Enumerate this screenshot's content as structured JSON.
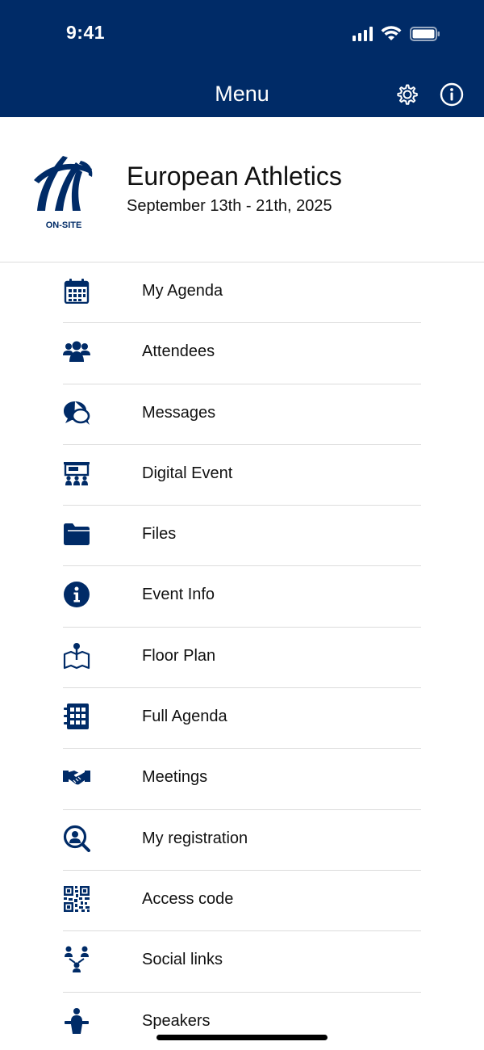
{
  "status_bar": {
    "time": "9:41"
  },
  "nav": {
    "title": "Menu",
    "settings_icon": "gear-icon",
    "info_icon": "info-circle-icon"
  },
  "event": {
    "name": "European Athletics",
    "dates": "September 13th - 21th, 2025",
    "logo_text": "ON-SITE"
  },
  "menu": {
    "items": [
      {
        "label": "My Agenda",
        "icon": "calendar-icon"
      },
      {
        "label": "Attendees",
        "icon": "people-icon"
      },
      {
        "label": "Messages",
        "icon": "chat-bubbles-icon"
      },
      {
        "label": "Digital Event",
        "icon": "presentation-audience-icon"
      },
      {
        "label": "Files",
        "icon": "folder-icon"
      },
      {
        "label": "Event Info",
        "icon": "info-icon"
      },
      {
        "label": "Floor Plan",
        "icon": "map-pin-icon"
      },
      {
        "label": "Full Agenda",
        "icon": "grid-notebook-icon"
      },
      {
        "label": "Meetings",
        "icon": "handshake-icon"
      },
      {
        "label": "My registration",
        "icon": "user-search-icon"
      },
      {
        "label": "Access code",
        "icon": "qr-code-icon"
      },
      {
        "label": "Social links",
        "icon": "network-icon"
      },
      {
        "label": "Speakers",
        "icon": "speaker-podium-icon"
      }
    ]
  },
  "colors": {
    "brand": "#002b67",
    "divider": "#dcdcdc",
    "text": "#111111"
  }
}
